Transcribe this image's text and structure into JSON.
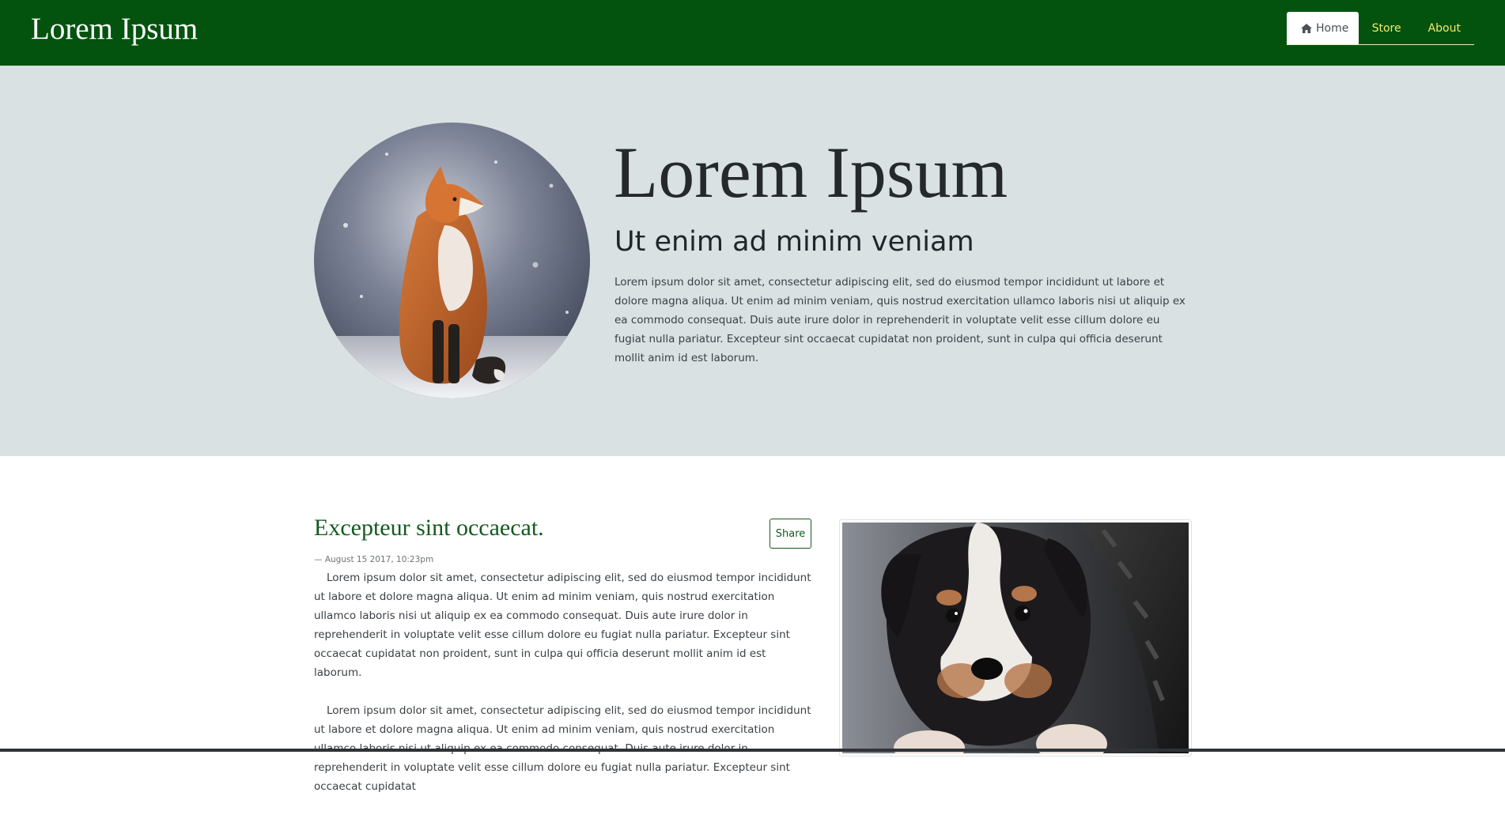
{
  "header": {
    "brand": "Lorem Ipsum",
    "nav": [
      {
        "label": "Home",
        "icon": "home-icon",
        "active": true
      },
      {
        "label": "Store",
        "active": false
      },
      {
        "label": "About",
        "active": false
      }
    ]
  },
  "hero": {
    "title": "Lorem Ipsum",
    "subtitle": "Ut enim ad minim veniam",
    "text": "Lorem ipsum dolor sit amet, consectetur adipiscing elit, sed do eiusmod tempor incididunt ut labore et dolore magna aliqua. Ut enim ad minim veniam, quis nostrud exercitation ullamco laboris nisi ut aliquip ex ea commodo consequat. Duis aute irure dolor in reprehenderit in voluptate velit esse cillum dolore eu fugiat nulla pariatur. Excepteur sint occaecat cupidatat non proident, sunt in culpa qui officia deserunt mollit anim id est laborum.",
    "image": "fox-photo"
  },
  "post": {
    "title": "Excepteur sint occaecat.",
    "share_label": "Share",
    "date": "— August 15 2017, 10:23pm",
    "paragraphs": [
      "Lorem ipsum dolor sit amet, consectetur adipiscing elit, sed do eiusmod tempor incididunt ut labore et dolore magna aliqua. Ut enim ad minim veniam, quis nostrud exercitation ullamco laboris nisi ut aliquip ex ea commodo consequat. Duis aute irure dolor in reprehenderit in voluptate velit esse cillum dolore eu fugiat nulla pariatur. Excepteur sint occaecat cupidatat non proident, sunt in culpa qui officia deserunt mollit anim id est laborum.",
      "Lorem ipsum dolor sit amet, consectetur adipiscing elit, sed do eiusmod tempor incididunt ut labore et dolore magna aliqua. Ut enim ad minim veniam, quis nostrud exercitation ullamco laboris nisi ut aliquip ex ea commodo consequat. Duis aute irure dolor in reprehenderit in voluptate velit esse cillum dolore eu fugiat nulla pariatur. Excepteur sint occaecat cupidatat"
    ],
    "side_image": "puppy-photo"
  },
  "colors": {
    "navbar": "#03530f",
    "nav_link": "#f4e96c",
    "hero_bg": "#d9e1e3",
    "accent": "#145a1e"
  }
}
